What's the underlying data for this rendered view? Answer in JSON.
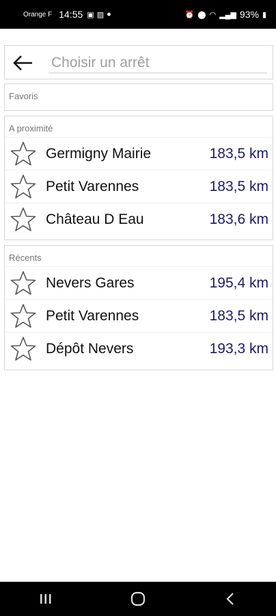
{
  "status_bar": {
    "carrier": "Orange F",
    "time": "14:55",
    "battery": "93%"
  },
  "search": {
    "placeholder": "Choisir un arrêt"
  },
  "favorites": {
    "title": "Favoris"
  },
  "nearby": {
    "title": "A proximité",
    "items": [
      {
        "name": "Germigny Mairie",
        "distance": "183,5 km"
      },
      {
        "name": "Petit Varennes",
        "distance": "183,5 km"
      },
      {
        "name": "Château D Eau",
        "distance": "183,6 km"
      }
    ]
  },
  "recent": {
    "title": "Récents",
    "items": [
      {
        "name": "Nevers Gares",
        "distance": "195,4 km"
      },
      {
        "name": "Petit Varennes",
        "distance": "183,5 km"
      },
      {
        "name": "Dépôt Nevers",
        "distance": "193,3 km"
      }
    ]
  },
  "colors": {
    "distance_text": "#1a1a6e",
    "border": "#d6d6d6",
    "section_title": "#757575"
  },
  "icons": {
    "back": "arrow-left-icon",
    "favorite": "star-outline-icon",
    "nav_recent": "recent-apps-icon",
    "nav_home": "home-icon",
    "nav_back": "back-icon"
  }
}
